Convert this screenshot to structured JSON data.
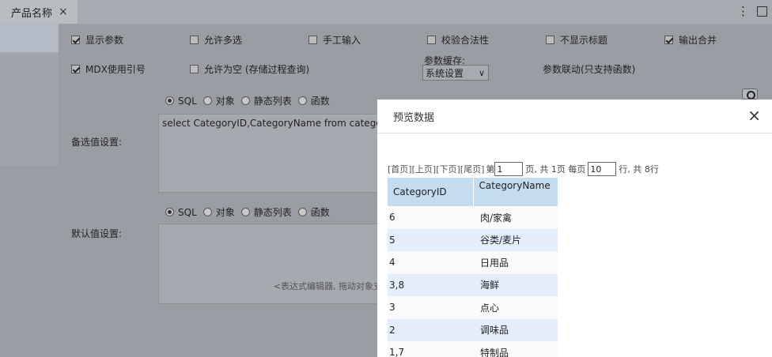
{
  "tab": {
    "title": "产品名称",
    "close": "×"
  },
  "window_icons": {
    "menu": "⋮"
  },
  "options_row1": [
    "显示参数",
    "允许多选",
    "手工输入",
    "校验合法性",
    "不显示标题",
    "输出合并"
  ],
  "options_row1_checked": [
    true,
    false,
    false,
    false,
    false,
    true
  ],
  "options_row2": [
    "MDX使用引号",
    "允许为空 (存储过程查询)"
  ],
  "options_row2_checked": [
    true,
    false
  ],
  "param_cache": {
    "label": "参数缓存:",
    "value": "系统设置",
    "chevron": "∨"
  },
  "param_link": "参数联动(只支持函数)",
  "source_radios": [
    "SQL",
    "对象",
    "静态列表",
    "函数"
  ],
  "candidate": {
    "label": "备选值设置:",
    "sql": "select  CategoryID,CategoryName  from catego"
  },
  "default_value": {
    "label": "默认值设置:",
    "placeholder": "<表达式编辑器, 拖动对象支"
  },
  "dialog": {
    "title": "预览数据",
    "close": "×",
    "pager": {
      "first": "[首页]",
      "prev": "[上页]",
      "next": "[下页]",
      "last": "[尾页]",
      "page_prefix": "第",
      "page_value": "1",
      "page_suffix": "页, 共 1页 每页",
      "rows_value": "10",
      "rows_suffix": "行, 共 8行"
    },
    "columns": [
      "CategoryID",
      "CategoryName"
    ],
    "rows": [
      [
        "6",
        "肉/家禽"
      ],
      [
        "5",
        "谷类/麦片"
      ],
      [
        "4",
        "日用品"
      ],
      [
        "3,8",
        "海鲜"
      ],
      [
        "3",
        "点心"
      ],
      [
        "2",
        "调味品"
      ],
      [
        "1,7",
        "特制品"
      ]
    ]
  }
}
